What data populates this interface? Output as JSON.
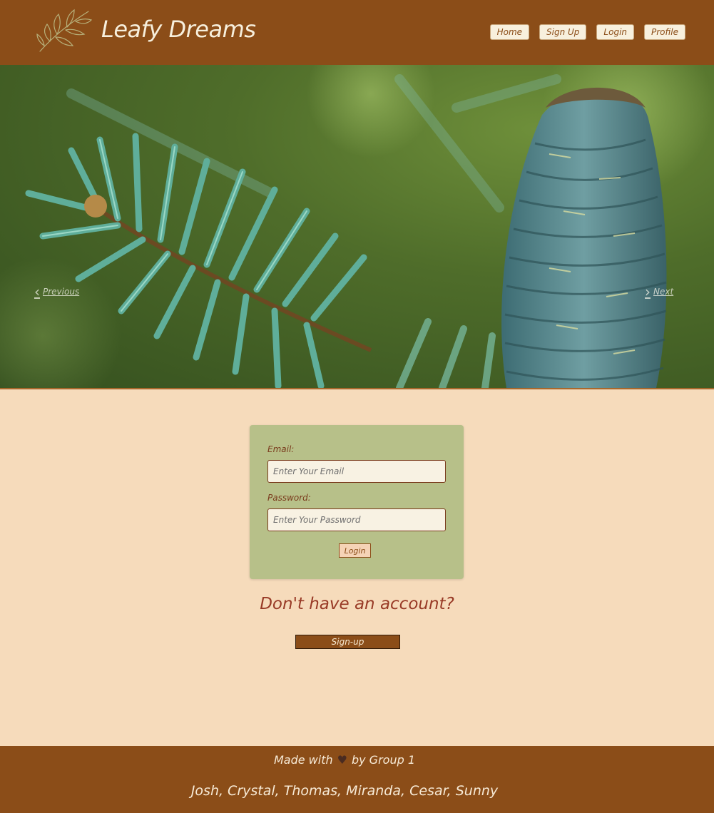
{
  "header": {
    "title": "Leafy Dreams",
    "logo_icon": "leaf-sprig-icon",
    "nav": [
      {
        "label": "Home"
      },
      {
        "label": "Sign Up"
      },
      {
        "label": "Login"
      },
      {
        "label": "Profile"
      }
    ]
  },
  "carousel": {
    "prev_label": "Previous",
    "next_label": "Next",
    "prev_icon": "chevron-left-icon",
    "next_icon": "chevron-right-icon",
    "image_subject": "fir-branch-with-cone"
  },
  "login_form": {
    "email_label": "Email:",
    "email_placeholder": "Enter Your Email",
    "email_value": "",
    "password_label": "Password:",
    "password_placeholder": "Enter Your Password",
    "password_value": "",
    "submit_label": "Login"
  },
  "signup": {
    "prompt": "Don't have an account?",
    "button_label": "Sign-up"
  },
  "footer": {
    "made_with_prefix": "Made with",
    "made_with_suffix": "by Group 1",
    "heart_icon": "heart-icon",
    "members": "Josh, Crystal, Thomas, Miranda, Cesar, Sunny"
  },
  "colors": {
    "header_bg": "#8b4d18",
    "page_bg": "#f6dbbb",
    "card_bg": "#b7c089",
    "accent_text": "#983a26"
  }
}
